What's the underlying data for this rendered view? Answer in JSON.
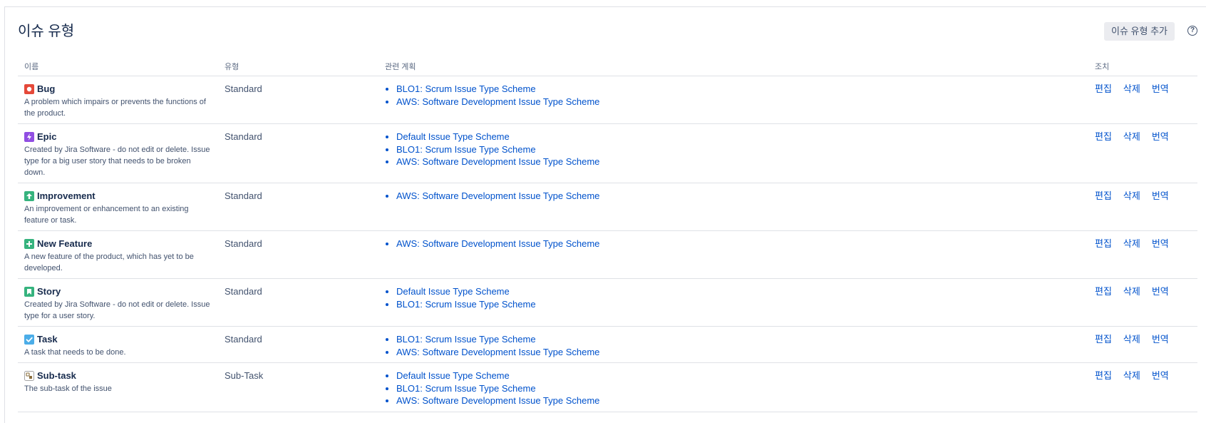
{
  "page": {
    "title": "이슈 유형",
    "add_button": "이슈 유형 추가",
    "help_icon": "?"
  },
  "table": {
    "headers": {
      "name": "이름",
      "type": "유형",
      "schemes": "관련 계획",
      "actions": "조치"
    },
    "action_labels": {
      "edit": "편집",
      "delete": "삭제",
      "translate": "번역"
    },
    "rows": [
      {
        "icon": "bug-icon",
        "icon_color": "#e5493a",
        "name": "Bug",
        "description": "A problem which impairs or prevents the functions of the product.",
        "type": "Standard",
        "schemes": [
          "BLO1: Scrum Issue Type Scheme",
          "AWS: Software Development Issue Type Scheme"
        ]
      },
      {
        "icon": "epic-icon",
        "icon_color": "#904ee2",
        "name": "Epic",
        "description": "Created by Jira Software - do not edit or delete. Issue type for a big user story that needs to be broken down.",
        "type": "Standard",
        "schemes": [
          "Default Issue Type Scheme",
          "BLO1: Scrum Issue Type Scheme",
          "AWS: Software Development Issue Type Scheme"
        ]
      },
      {
        "icon": "improvement-icon",
        "icon_color": "#36b37e",
        "name": "Improvement",
        "description": "An improvement or enhancement to an existing feature or task.",
        "type": "Standard",
        "schemes": [
          "AWS: Software Development Issue Type Scheme"
        ]
      },
      {
        "icon": "new-feature-icon",
        "icon_color": "#36b37e",
        "name": "New Feature",
        "description": "A new feature of the product, which has yet to be developed.",
        "type": "Standard",
        "schemes": [
          "AWS: Software Development Issue Type Scheme"
        ]
      },
      {
        "icon": "story-icon",
        "icon_color": "#36b37e",
        "name": "Story",
        "description": "Created by Jira Software - do not edit or delete. Issue type for a user story.",
        "type": "Standard",
        "schemes": [
          "Default Issue Type Scheme",
          "BLO1: Scrum Issue Type Scheme"
        ]
      },
      {
        "icon": "task-icon",
        "icon_color": "#4bade8",
        "name": "Task",
        "description": "A task that needs to be done.",
        "type": "Standard",
        "schemes": [
          "BLO1: Scrum Issue Type Scheme",
          "AWS: Software Development Issue Type Scheme"
        ]
      },
      {
        "icon": "sub-task-icon",
        "icon_color": "#a5a5a5",
        "name": "Sub-task",
        "description": "The sub-task of the issue",
        "type": "Sub-Task",
        "schemes": [
          "Default Issue Type Scheme",
          "BLO1: Scrum Issue Type Scheme",
          "AWS: Software Development Issue Type Scheme"
        ]
      }
    ]
  }
}
